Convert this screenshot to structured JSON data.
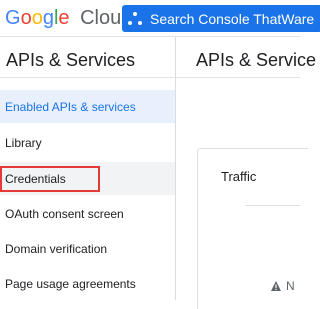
{
  "header": {
    "brand": "Google",
    "product": "Cloud",
    "project_label": "Search Console ThatWare",
    "project_icon": "project-dots-icon"
  },
  "sidebar": {
    "title": "APIs & Services",
    "items": [
      {
        "label": "Enabled APIs & services",
        "state": "active"
      },
      {
        "label": "Library",
        "state": "normal"
      },
      {
        "label": "Credentials",
        "state": "hover"
      },
      {
        "label": "OAuth consent screen",
        "state": "normal"
      },
      {
        "label": "Domain verification",
        "state": "normal"
      },
      {
        "label": "Page usage agreements",
        "state": "normal"
      }
    ]
  },
  "main": {
    "title": "APIs & Service",
    "card_title": "Traffic",
    "warning_text": "N",
    "warning_icon": "warning-icon"
  },
  "colors": {
    "accent": "#1a73e8",
    "active_bg": "#e8f0fe",
    "highlight": "#e53935"
  }
}
